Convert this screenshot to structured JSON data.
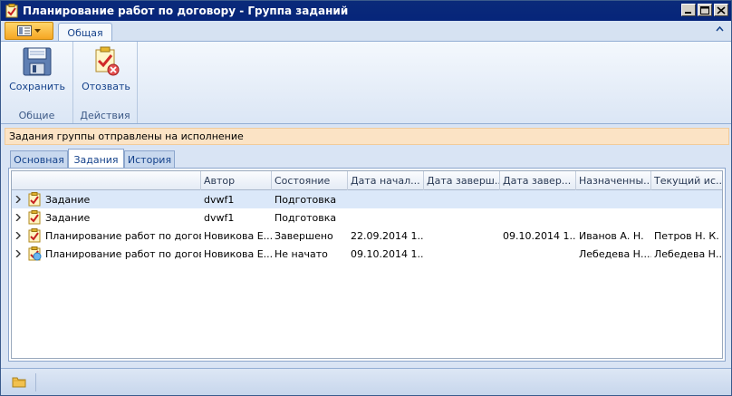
{
  "window": {
    "title": "Планирование работ по договору - Группа заданий"
  },
  "ribbon": {
    "tabs": [
      {
        "label": "Общая"
      }
    ],
    "groups": [
      {
        "label": "Общие",
        "buttons": [
          {
            "label": "Сохранить",
            "icon": "save-icon"
          }
        ]
      },
      {
        "label": "Действия",
        "buttons": [
          {
            "label": "Отозвать",
            "icon": "revoke-icon"
          }
        ]
      }
    ]
  },
  "info_message": "Задания группы отправлены на исполнение",
  "doc_tabs": [
    {
      "label": "Основная"
    },
    {
      "label": "Задания"
    },
    {
      "label": "История"
    }
  ],
  "grid": {
    "columns": [
      {
        "label": ""
      },
      {
        "label": "Автор"
      },
      {
        "label": "Состояние"
      },
      {
        "label": "Дата начал..."
      },
      {
        "label": "Дата заверш..."
      },
      {
        "label": "Дата завер..."
      },
      {
        "label": "Назначенны..."
      },
      {
        "label": "Текущий ис..."
      }
    ],
    "rows": [
      {
        "name": "Задание",
        "author": "dvwf1",
        "state": "Подготовка",
        "start": "",
        "end_plan": "",
        "end_fact": "",
        "assigned": "",
        "current": "",
        "icon": "task-check-icon"
      },
      {
        "name": "Задание",
        "author": "dvwf1",
        "state": "Подготовка",
        "start": "",
        "end_plan": "",
        "end_fact": "",
        "assigned": "",
        "current": "",
        "icon": "task-check-icon"
      },
      {
        "name": "Планирование работ по догов...",
        "author": "Новикова Е....",
        "state": "Завершено",
        "start": "22.09.2014 1...",
        "end_plan": "",
        "end_fact": "09.10.2014 1...",
        "assigned": "Иванов А. Н.",
        "current": "Петров Н. К.",
        "icon": "task-check-icon"
      },
      {
        "name": "Планирование работ по догов...",
        "author": "Новикова Е....",
        "state": "Не начато",
        "start": "09.10.2014 1...",
        "end_plan": "",
        "end_fact": "",
        "assigned": "Лебедева Н....",
        "current": "Лебедева Н....",
        "icon": "task-new-icon"
      }
    ]
  },
  "colors": {
    "title_bar": "#06257a",
    "info_bar": "#fbe3c5",
    "selected_row": "#dbe8f9",
    "app_menu": "#f6a623"
  }
}
